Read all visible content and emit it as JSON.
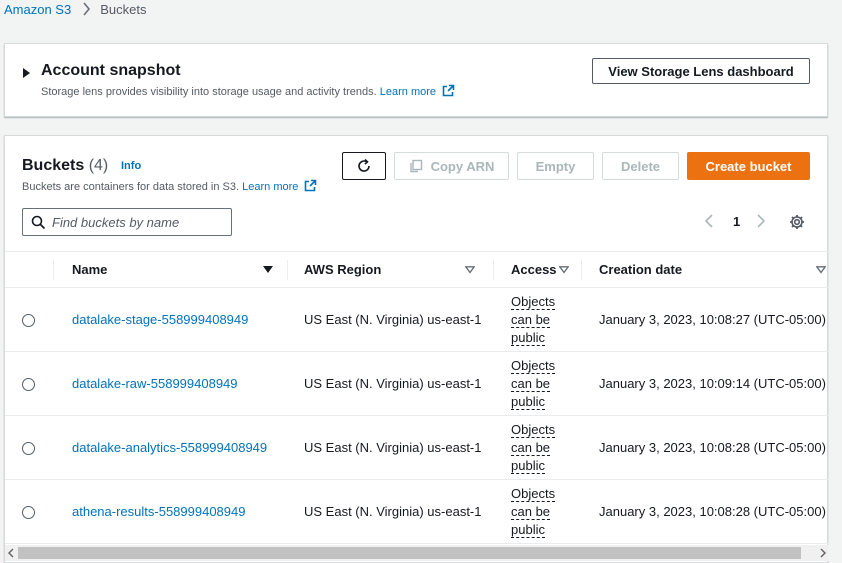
{
  "breadcrumb": {
    "root": "Amazon S3",
    "current": "Buckets"
  },
  "snapshot": {
    "title": "Account snapshot",
    "description": "Storage lens provides visibility into storage usage and activity trends.",
    "learn_more": "Learn more",
    "dashboard_button": "View Storage Lens dashboard"
  },
  "buckets_panel": {
    "title": "Buckets",
    "count": "(4)",
    "info": "Info",
    "description": "Buckets are containers for data stored in S3.",
    "learn_more": "Learn more",
    "buttons": {
      "copy_arn": "Copy ARN",
      "empty": "Empty",
      "delete": "Delete",
      "create": "Create bucket"
    },
    "search": {
      "placeholder": "Find buckets by name",
      "value": ""
    },
    "pagination": {
      "current_page": "1"
    },
    "columns": [
      "Name",
      "AWS Region",
      "Access",
      "Creation date"
    ],
    "rows": [
      {
        "name": "datalake-stage-558999408949",
        "region": "US East (N. Virginia) us-east-1",
        "access_1": "Objects can be",
        "access_2": "public",
        "created": "January 3, 2023, 10:08:27 (UTC-05:00)"
      },
      {
        "name": "datalake-raw-558999408949",
        "region": "US East (N. Virginia) us-east-1",
        "access_1": "Objects can be",
        "access_2": "public",
        "created": "January 3, 2023, 10:09:14 (UTC-05:00)"
      },
      {
        "name": "datalake-analytics-558999408949",
        "region": "US East (N. Virginia) us-east-1",
        "access_1": "Objects can be",
        "access_2": "public",
        "created": "January 3, 2023, 10:08:28 (UTC-05:00)"
      },
      {
        "name": "athena-results-558999408949",
        "region": "US East (N. Virginia) us-east-1",
        "access_1": "Objects can be",
        "access_2": "public",
        "created": "January 3, 2023, 10:08:28 (UTC-05:00)"
      }
    ]
  },
  "colors": {
    "link": "#0073bb",
    "primary": "#ec7211",
    "disabled": "#aab7b8"
  },
  "icons": [
    "chevron-right-icon",
    "external-link-icon",
    "refresh-icon",
    "copy-icon",
    "search-icon",
    "chevron-left-icon",
    "gear-icon",
    "sort-caret-icon"
  ]
}
